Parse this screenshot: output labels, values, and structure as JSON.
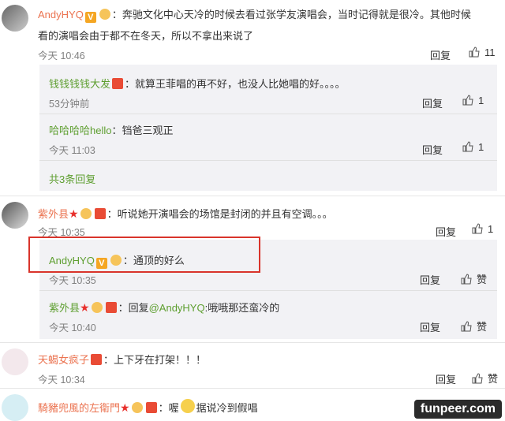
{
  "comments": [
    {
      "user": "AndyHYQ",
      "text": "：奔驰文化中心天冷的时候去看过张学友演唱会，当时记得就是很冷。其他时候",
      "text2": "看的演唱会由于都不在冬天，所以不拿出来说了",
      "time": "今天 10:46",
      "reply": "回复",
      "likes": "11",
      "replies": [
        {
          "user": "钱钱钱钱大发",
          "text": "：就算王菲唱的再不好，也没人比她唱的好。。。。",
          "time": "53分钟前",
          "reply": "回复",
          "likes": "1"
        },
        {
          "user": "哈哈哈哈hello",
          "text": "：铛爸三观正",
          "time": "今天 11:03",
          "reply": "回复",
          "likes": "1"
        }
      ],
      "more": "共3条回复"
    },
    {
      "user": "紫外县",
      "text": "：听说她开演唱会的场馆是封闭的并且有空调。。。",
      "time": "今天 10:35",
      "reply": "回复",
      "likes": "1",
      "replies": [
        {
          "user": "AndyHYQ",
          "text": "：通顶的好么",
          "time": "今天 10:35",
          "reply": "回复",
          "likes": "赞"
        },
        {
          "user": "紫外县",
          "text_prefix": "：回复",
          "mention": "@AndyHYQ",
          "text": ":哦哦那还蛮冷的",
          "time": "今天 10:40",
          "reply": "回复",
          "likes": "赞"
        }
      ]
    },
    {
      "user": "天蝎女疯子",
      "text": "：上下牙在打架！！！",
      "time": "今天 10:34",
      "reply": "回复",
      "likes": "赞"
    },
    {
      "user": "騎豬兜風的左衛門",
      "text_prefix": "：喔",
      "text": "据说冷到假唱"
    }
  ],
  "watermark": "funpeer.com",
  "colors": {
    "username": "#eb7350",
    "reply_user": "#5d9e2f",
    "highlight": "#d9342b"
  }
}
